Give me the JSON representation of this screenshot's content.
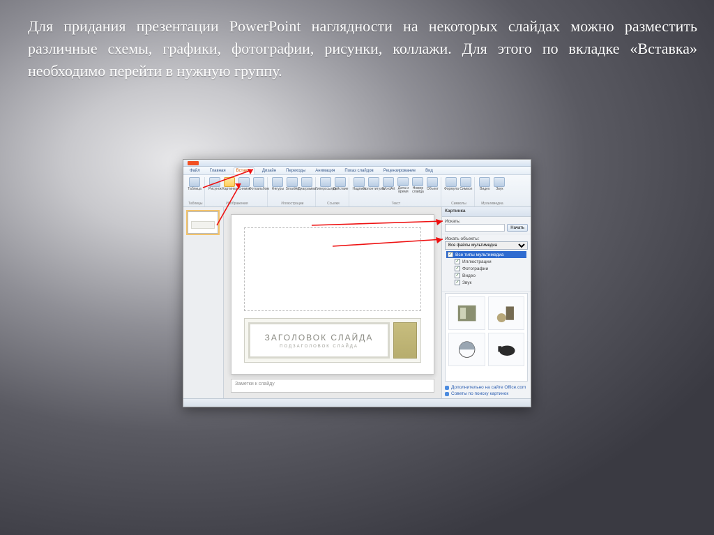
{
  "body_text": "Для придания презентации PowerPoint наглядности на некоторых слайдах можно разместить различные схемы, графики, фотографии, рисунки, коллажи. Для этого по вкладке «Вставка» необходимо перейти в нужную группу.",
  "ppt": {
    "tabs": [
      "Файл",
      "Главная",
      "Вставка",
      "Дизайн",
      "Переходы",
      "Анимация",
      "Показ слайдов",
      "Рецензирование",
      "Вид"
    ],
    "active_tab": "Вставка",
    "ribbon_groups": [
      {
        "label": "Таблицы",
        "items": [
          "Таблица"
        ]
      },
      {
        "label": "Изображения",
        "items": [
          "Рисунок",
          "Картинка",
          "Снимок",
          "Фотоальбом"
        ]
      },
      {
        "label": "Иллюстрации",
        "items": [
          "Фигуры",
          "SmartArt",
          "Диаграмма"
        ]
      },
      {
        "label": "Ссылки",
        "items": [
          "Гиперссылка",
          "Действие"
        ]
      },
      {
        "label": "Текст",
        "items": [
          "Надпись",
          "Колонтитулы",
          "WordArt",
          "Дата и время",
          "Номер слайда",
          "Объект"
        ]
      },
      {
        "label": "Символы",
        "items": [
          "Формула",
          "Символ"
        ]
      },
      {
        "label": "Мультимедиа",
        "items": [
          "Видео",
          "Звук"
        ]
      }
    ],
    "highlighted_item": "Картинка",
    "slide_title": "ЗАГОЛОВОК СЛАЙДА",
    "slide_subtitle": "ПОДЗАГОЛОВОК СЛАЙДА",
    "notes_placeholder": "Заметки к слайду",
    "task_pane": {
      "title": "Картинка",
      "search_label": "Искать:",
      "search_button": "Начать",
      "scope_label": "Искать объекты:",
      "scope_value": "Все файлы мультимедиа",
      "tree": [
        {
          "label": "Все типы мультимедиа",
          "selected": true,
          "checked": true
        },
        {
          "label": "Иллюстрации",
          "selected": false,
          "checked": true
        },
        {
          "label": "Фотографии",
          "selected": false,
          "checked": true
        },
        {
          "label": "Видео",
          "selected": false,
          "checked": true
        },
        {
          "label": "Звук",
          "selected": false,
          "checked": true
        }
      ],
      "footer_links": [
        "Дополнительно на сайте Office.com",
        "Советы по поиску картинок"
      ]
    }
  }
}
